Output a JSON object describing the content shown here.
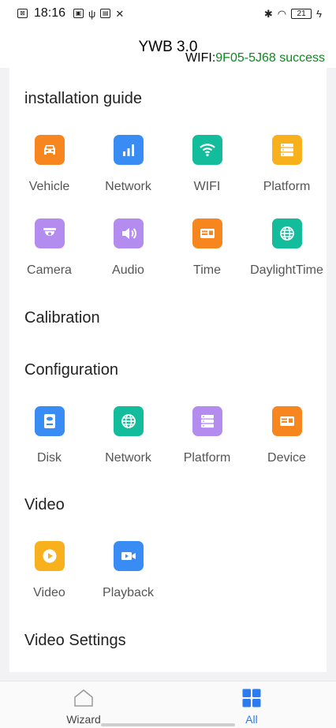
{
  "status_bar": {
    "time": "18:16",
    "battery": "21"
  },
  "header": {
    "title": "YWB 3.0",
    "wifi_label": "WIFI:",
    "wifi_value": "9F05-5J68 success"
  },
  "sections": {
    "installation": {
      "title": "installation guide",
      "items": [
        {
          "label": "Vehicle",
          "icon": "car-icon",
          "color": "#f7861e"
        },
        {
          "label": "Network",
          "icon": "signal-bars-icon",
          "color": "#3a8cf5"
        },
        {
          "label": "WIFI",
          "icon": "wifi-icon",
          "color": "#13bc9a"
        },
        {
          "label": "Platform",
          "icon": "server-icon",
          "color": "#f8b01d"
        },
        {
          "label": "Camera",
          "icon": "camera-dome-icon",
          "color": "#b48cf0"
        },
        {
          "label": "Audio",
          "icon": "speaker-icon",
          "color": "#b48cf0"
        },
        {
          "label": "Time",
          "icon": "clock-panel-icon",
          "color": "#f7861e"
        },
        {
          "label": "DaylightTime",
          "icon": "globe-icon",
          "color": "#13bc9a"
        }
      ]
    },
    "calibration": {
      "title": "Calibration"
    },
    "configuration": {
      "title": "Configuration",
      "items": [
        {
          "label": "Disk",
          "icon": "disk-icon",
          "color": "#3a8cf5"
        },
        {
          "label": "Network",
          "icon": "globe-icon",
          "color": "#13bc9a"
        },
        {
          "label": "Platform",
          "icon": "server-icon",
          "color": "#b48cf0"
        },
        {
          "label": "Device",
          "icon": "device-icon",
          "color": "#f7861e"
        }
      ]
    },
    "video": {
      "title": "Video",
      "items": [
        {
          "label": "Video",
          "icon": "play-icon",
          "color": "#f8b01d"
        },
        {
          "label": "Playback",
          "icon": "video-camera-icon",
          "color": "#3a8cf5"
        }
      ]
    },
    "video_settings": {
      "title": "Video Settings"
    }
  },
  "bottom_nav": {
    "wizard_label": "Wizard",
    "all_label": "All",
    "active_color": "#2c7cf0"
  }
}
